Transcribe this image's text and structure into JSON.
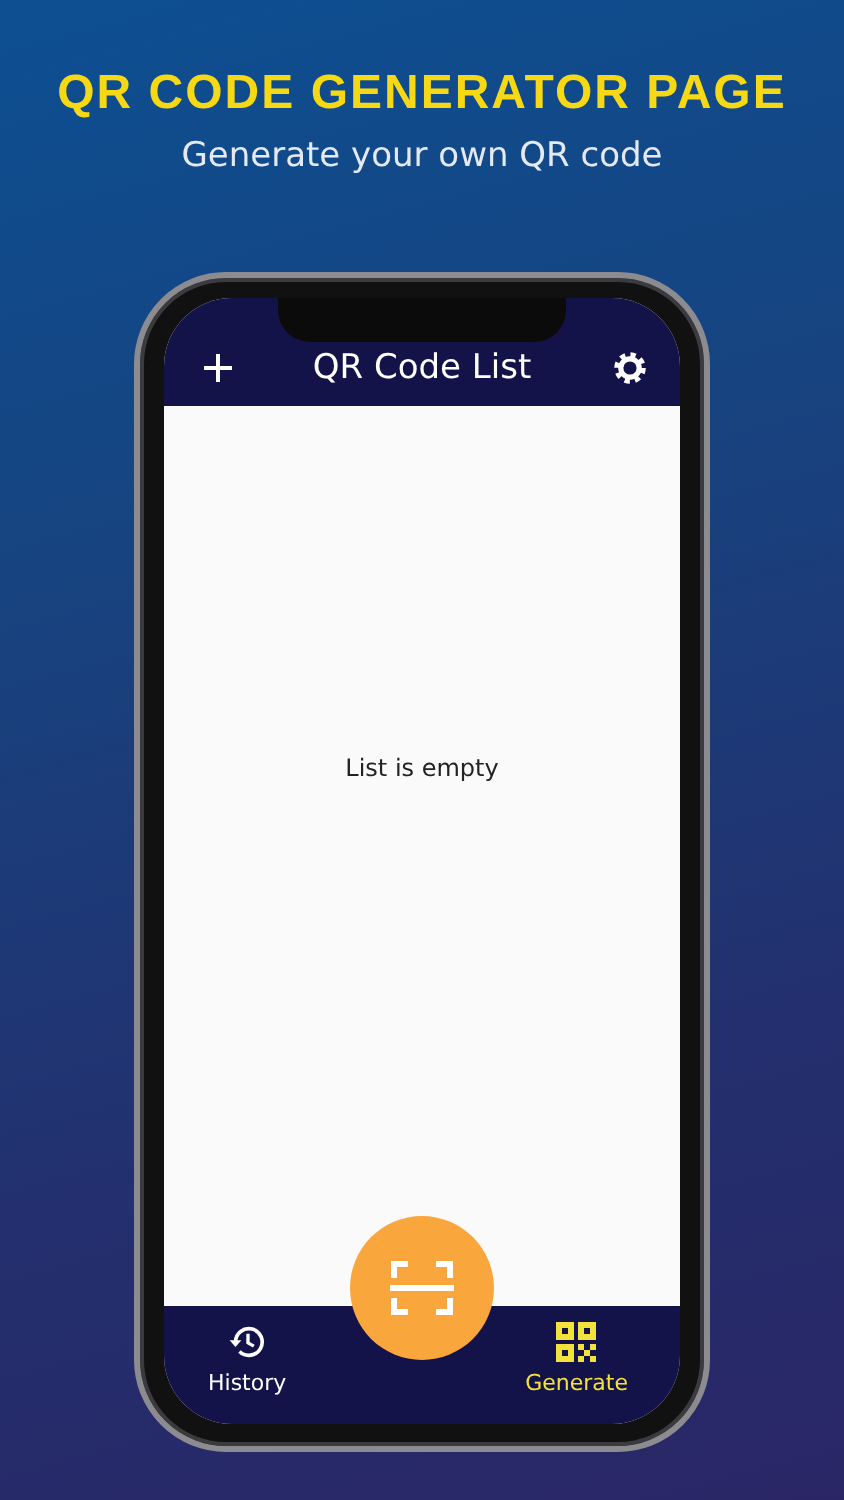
{
  "banner": {
    "title": "QR CODE GENERATOR PAGE",
    "subtitle": "Generate your own QR code"
  },
  "app_bar": {
    "title": "QR Code List"
  },
  "list": {
    "empty_message": "List is empty"
  },
  "bottom_nav": [
    {
      "label": "History",
      "kind": "history",
      "selected": false
    },
    {
      "label": "Generate",
      "kind": "qr",
      "selected": true
    }
  ]
}
